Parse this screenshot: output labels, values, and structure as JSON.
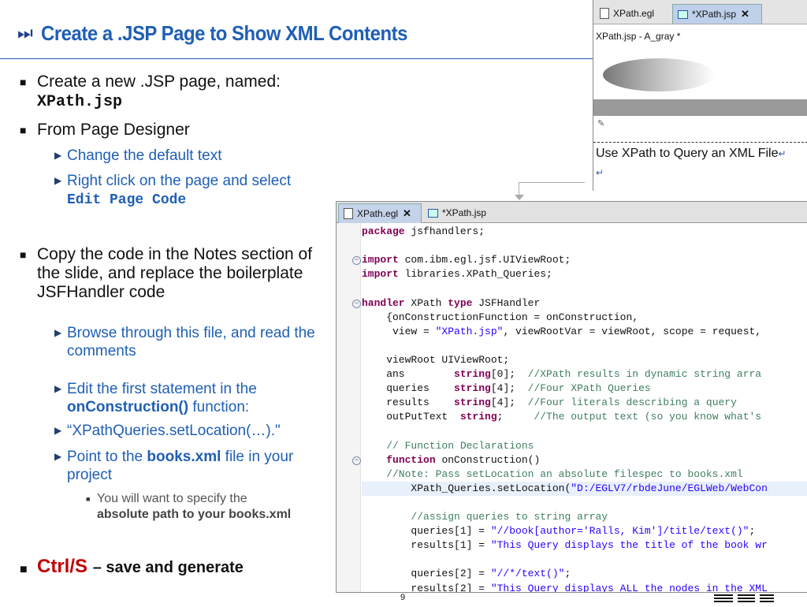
{
  "slide": {
    "title_icon": "⏭",
    "title": "Create a .JSP Page to Show XML Contents",
    "page_number": "9",
    "logo": "IBM"
  },
  "bullets": {
    "b1_text": "Create a new .JSP page, named:",
    "b1_code": "XPath.jsp",
    "b2_text": "From Page Designer",
    "s1": "Change the default text",
    "s2_text": "Right click on the page and select",
    "s2_bold": "Edit Page Code",
    "b3_text": "Copy the code in the Notes section of the slide, and replace the boilerplate JSFHandler code",
    "s3": "Browse through this file, and read the comments",
    "s4_text": "Edit the first statement in the",
    "s4_bold": "onConstruction()",
    "s4_tail": "function:",
    "s5": "“XPathQueries.setLocation(…).\"",
    "s6_pre": "Point to the",
    "s6_bold": "books.xml",
    "s6_tail": "file in your project",
    "ss1_text": "You will want to specify the",
    "ss1_bold": "absolute path to your books.xml",
    "b4_red": "Ctrl/S",
    "b4_tail": "– save and generate"
  },
  "design_view": {
    "tabs": [
      "XPath.egl",
      "*XPath.jsp"
    ],
    "page_label": "XPath.jsp - A_gray *",
    "heading_text": "Use XPath to Query an XML File",
    "return_mark": "↵"
  },
  "editor": {
    "tabs": [
      "XPath.egl",
      "*XPath.jsp"
    ],
    "lines": [
      {
        "seg": [
          [
            "kw",
            "package"
          ],
          [
            "t",
            " jsfhandlers;"
          ]
        ]
      },
      {
        "seg": []
      },
      {
        "fold": true,
        "seg": [
          [
            "kw",
            "import"
          ],
          [
            "t",
            " com.ibm.egl.jsf.UIViewRoot;"
          ]
        ]
      },
      {
        "seg": [
          [
            "kw",
            "import"
          ],
          [
            "t",
            " libraries.XPath_Queries;"
          ]
        ]
      },
      {
        "seg": []
      },
      {
        "fold": true,
        "seg": [
          [
            "kw",
            "handler"
          ],
          [
            "t",
            " XPath "
          ],
          [
            "kw",
            "type"
          ],
          [
            "t",
            " JSFHandler"
          ]
        ]
      },
      {
        "seg": [
          [
            "t",
            "    {onConstructionFunction = onConstruction,"
          ]
        ]
      },
      {
        "seg": [
          [
            "t",
            "     view = "
          ],
          [
            "str",
            "\"XPath.jsp\""
          ],
          [
            "t",
            ", viewRootVar = viewRoot, scope = request,"
          ]
        ]
      },
      {
        "seg": []
      },
      {
        "seg": [
          [
            "t",
            "    viewRoot UIViewRoot;"
          ]
        ]
      },
      {
        "seg": [
          [
            "t",
            "    ans        "
          ],
          [
            "kw",
            "string"
          ],
          [
            "t",
            "[0];  "
          ],
          [
            "cm",
            "//XPath results in dynamic string arra"
          ]
        ]
      },
      {
        "seg": [
          [
            "t",
            "    queries    "
          ],
          [
            "kw",
            "string"
          ],
          [
            "t",
            "[4];  "
          ],
          [
            "cm",
            "//Four XPath Queries"
          ]
        ]
      },
      {
        "seg": [
          [
            "t",
            "    results    "
          ],
          [
            "kw",
            "string"
          ],
          [
            "t",
            "[4];  "
          ],
          [
            "cm",
            "//Four literals describing a query"
          ]
        ]
      },
      {
        "seg": [
          [
            "t",
            "    outPutText  "
          ],
          [
            "kw",
            "string"
          ],
          [
            "t",
            ";     "
          ],
          [
            "cm",
            "//The output text (so you know what's"
          ]
        ]
      },
      {
        "seg": []
      },
      {
        "seg": [
          [
            "cm",
            "    // Function Declarations"
          ]
        ]
      },
      {
        "fold": true,
        "seg": [
          [
            "t",
            "    "
          ],
          [
            "kw",
            "function"
          ],
          [
            "t",
            " onConstruction()"
          ]
        ]
      },
      {
        "seg": [
          [
            "cm",
            "    //Note: Pass setLocation an absolute filespec to books.xml"
          ]
        ]
      },
      {
        "hl": true,
        "seg": [
          [
            "t",
            "        XPath_Queries.setLocation("
          ],
          [
            "str",
            "\"D:/EGLV7/rbdeJune/EGLWeb/WebCon"
          ]
        ]
      },
      {
        "seg": []
      },
      {
        "seg": [
          [
            "cm",
            "        //assign queries to string array"
          ]
        ]
      },
      {
        "seg": [
          [
            "t",
            "        queries[1] = "
          ],
          [
            "str",
            "\"//book[author='Ralls, Kim']/title/text()\""
          ],
          [
            "t",
            ";"
          ]
        ]
      },
      {
        "seg": [
          [
            "t",
            "        results[1] = "
          ],
          [
            "str",
            "\"This Query displays the title of the book wr"
          ]
        ]
      },
      {
        "seg": []
      },
      {
        "seg": [
          [
            "t",
            "        queries[2] = "
          ],
          [
            "str",
            "\"//*/text()\""
          ],
          [
            "t",
            ";"
          ]
        ]
      },
      {
        "seg": [
          [
            "t",
            "        results[2] = "
          ],
          [
            "str",
            "\"This Query displays ALL the nodes in the XML"
          ]
        ]
      }
    ]
  }
}
